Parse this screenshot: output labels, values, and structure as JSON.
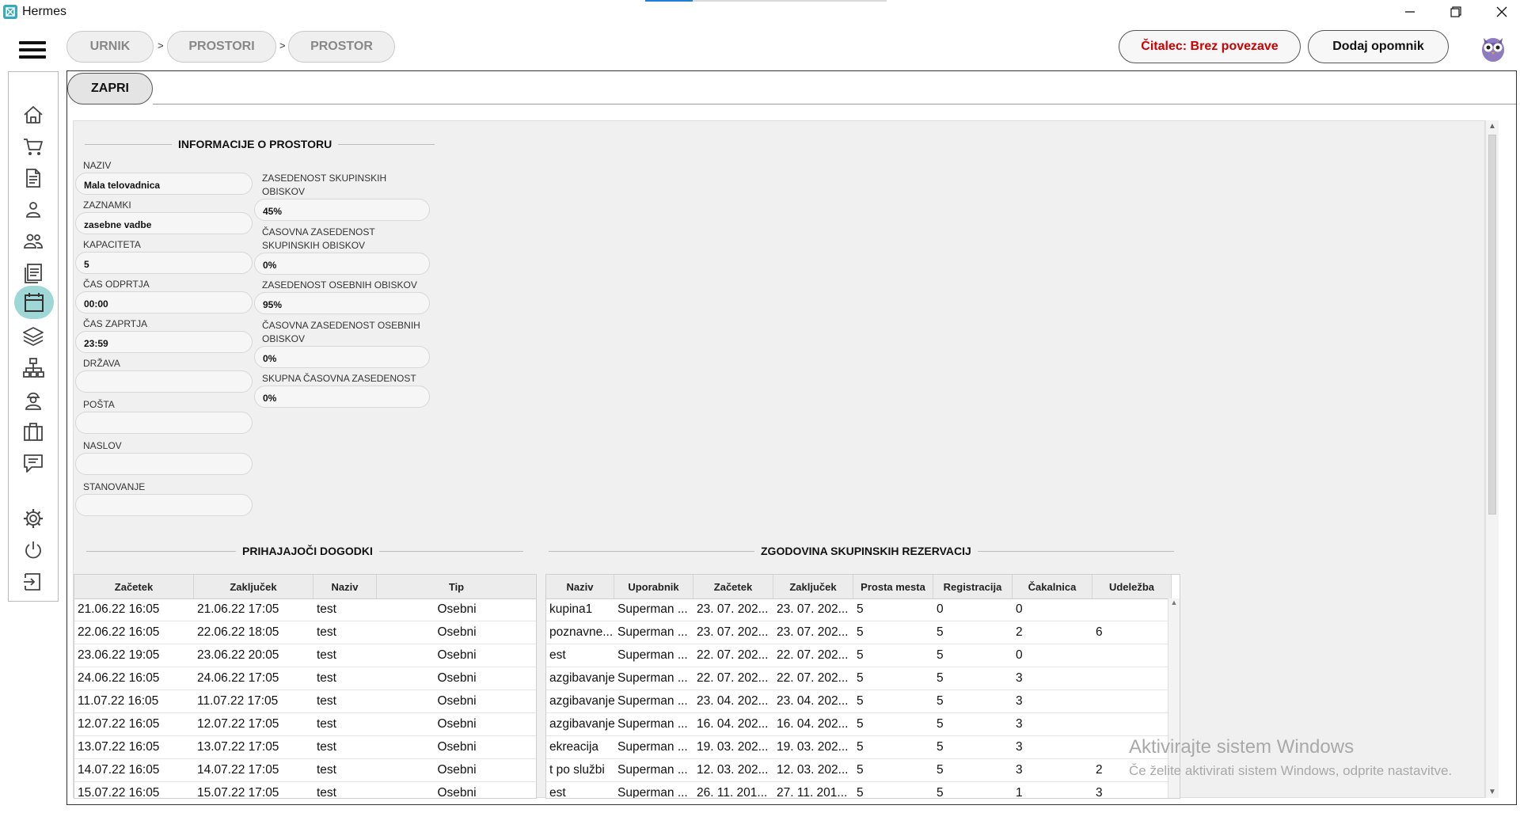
{
  "window": {
    "title": "Hermes"
  },
  "breadcrumb": [
    "URNIK",
    "PROSTORI",
    "PROSTOR"
  ],
  "breadcrumb_separator": ">",
  "header": {
    "reader_status": "Čitalec: Brez povezave",
    "reader_status_color": "#cc0000",
    "add_reminder": "Dodaj opomnik"
  },
  "toolbar": {
    "close_label": "ZAPRI"
  },
  "info": {
    "title": "INFORMACIJE O PROSTORU",
    "left_fields": [
      {
        "label": "NAZIV",
        "value": "Mala telovadnica"
      },
      {
        "label": "ZAZNAMKI",
        "value": "zasebne vadbe"
      },
      {
        "label": "KAPACITETA",
        "value": "5"
      },
      {
        "label": "ČAS ODPRTJA",
        "value": "00:00"
      },
      {
        "label": "ČAS ZAPRTJA",
        "value": "23:59"
      },
      {
        "label": "DRŽAVA",
        "value": ""
      },
      {
        "label": "POŠTA",
        "value": ""
      },
      {
        "label": "NASLOV",
        "value": ""
      },
      {
        "label": "STANOVANJE",
        "value": ""
      }
    ],
    "right_fields": [
      {
        "label_lines": [
          "ZASEDENOST SKUPINSKIH",
          "OBISKOV"
        ],
        "value": "45%"
      },
      {
        "label_lines": [
          "ČASOVNA ZASEDENOST",
          "SKUPINSKIH OBISKOV"
        ],
        "value": "0%"
      },
      {
        "label_lines": [
          "ZASEDENOST OSEBNIH OBISKOV"
        ],
        "value": "95%"
      },
      {
        "label_lines": [
          "ČASOVNA ZASEDENOST OSEBNIH",
          "OBISKOV"
        ],
        "value": "0%"
      },
      {
        "label_lines": [
          "SKUPNA ČASOVNA ZASEDENOST"
        ],
        "value": "0%"
      }
    ]
  },
  "upcoming": {
    "title": "PRIHAJAJOČI DOGODKI",
    "columns": [
      "Začetek",
      "Zaključek",
      "Naziv",
      "Tip"
    ],
    "rows": [
      [
        "21.06.22 16:05",
        "21.06.22 17:05",
        "test",
        "Osebni"
      ],
      [
        "22.06.22 16:05",
        "22.06.22 18:05",
        "test",
        "Osebni"
      ],
      [
        "23.06.22 19:05",
        "23.06.22 20:05",
        "test",
        "Osebni"
      ],
      [
        "24.06.22 16:05",
        "24.06.22 17:05",
        "test",
        "Osebni"
      ],
      [
        "11.07.22 16:05",
        "11.07.22 17:05",
        "test",
        "Osebni"
      ],
      [
        "12.07.22 16:05",
        "12.07.22 17:05",
        "test",
        "Osebni"
      ],
      [
        "13.07.22 16:05",
        "13.07.22 17:05",
        "test",
        "Osebni"
      ],
      [
        "14.07.22 16:05",
        "14.07.22 17:05",
        "test",
        "Osebni"
      ],
      [
        "15.07.22 16:05",
        "15.07.22 17:05",
        "test",
        "Osebni"
      ]
    ]
  },
  "history": {
    "title": "ZGODOVINA SKUPINSKIH REZERVACIJ",
    "columns": [
      "Naziv",
      "Uporabnik",
      "Začetek",
      "Zaključek",
      "Prosta mesta",
      "Registracija",
      "Čakalnica",
      "Udeležba"
    ],
    "rows": [
      [
        "kupina1",
        "Superman ...",
        "23. 07. 202...",
        "23. 07. 202...",
        "5",
        "0",
        "0",
        ""
      ],
      [
        "poznavne...",
        "Superman ...",
        "23. 07. 202...",
        "23. 07. 202...",
        "5",
        "5",
        "2",
        "6"
      ],
      [
        "est",
        "Superman ...",
        "22. 07. 202...",
        "22. 07. 202...",
        "5",
        "5",
        "0",
        ""
      ],
      [
        "azgibavanje",
        "Superman ...",
        "22. 07. 202...",
        "22. 07. 202...",
        "5",
        "5",
        "3",
        ""
      ],
      [
        "azgibavanje",
        "Superman ...",
        "23. 04. 202...",
        "23. 04. 202...",
        "5",
        "5",
        "3",
        ""
      ],
      [
        "azgibavanje",
        "Superman ...",
        "16. 04. 202...",
        "16. 04. 202...",
        "5",
        "5",
        "3",
        ""
      ],
      [
        "ekreacija",
        "Superman ...",
        "19. 03. 202...",
        "19. 03. 202...",
        "5",
        "5",
        "3",
        ""
      ],
      [
        "t po službi",
        "Superman ...",
        "12. 03. 202...",
        "12. 03. 202...",
        "5",
        "5",
        "3",
        "2"
      ],
      [
        "est",
        "Superman ...",
        "26. 11. 201...",
        "27. 11. 201...",
        "5",
        "5",
        "1",
        "3"
      ]
    ]
  },
  "watermark": {
    "line1": "Aktivirajte sistem Windows",
    "line2": "Če želite aktivirati sistem Windows, odprite nastavitve."
  },
  "sidebar_icons": [
    "home-icon",
    "cart-icon",
    "document-icon",
    "person-icon",
    "people-icon",
    "list-icon",
    "calendar-icon",
    "layers-icon",
    "network-icon",
    "worker-icon",
    "briefcase-icon",
    "chat-icon",
    "gear-icon",
    "power-icon",
    "logout-icon"
  ]
}
